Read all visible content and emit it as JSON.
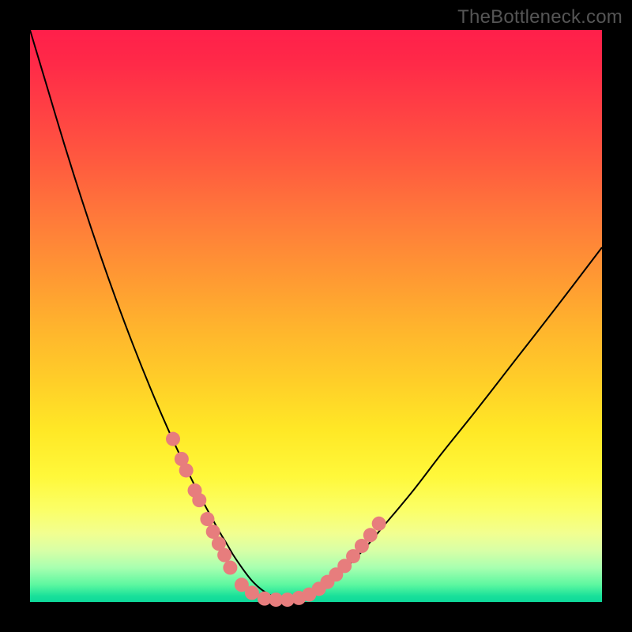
{
  "watermark": "TheBottleneck.com",
  "colors": {
    "bead": "#e77d7d",
    "curve": "#000000",
    "frame": "#000000"
  },
  "chart_data": {
    "type": "line",
    "title": "",
    "xlabel": "",
    "ylabel": "",
    "xlim": [
      0,
      100
    ],
    "ylim": [
      0,
      100
    ],
    "grid": false,
    "legend": false,
    "series": [
      {
        "name": "bottleneck-curve",
        "x": [
          0,
          3,
          6,
          9,
          12,
          15,
          18,
          21,
          24,
          27,
          30,
          33,
          34.5,
          36,
          39,
          42,
          45,
          48,
          51,
          54,
          58,
          62,
          67,
          72,
          78,
          85,
          92,
          100
        ],
        "y": [
          100,
          90,
          80,
          70.5,
          61.5,
          53,
          45,
          37.5,
          30.5,
          24,
          18,
          12.5,
          10,
          7.5,
          3.5,
          1.2,
          0.4,
          0.8,
          2.2,
          4.8,
          8.8,
          13.5,
          19.5,
          26,
          33.5,
          42.5,
          51.5,
          62
        ]
      }
    ],
    "beads": [
      {
        "x": 25.0,
        "y": 28.5
      },
      {
        "x": 26.5,
        "y": 25.0
      },
      {
        "x": 27.3,
        "y": 23.0
      },
      {
        "x": 28.8,
        "y": 19.5
      },
      {
        "x": 29.6,
        "y": 17.8
      },
      {
        "x": 31.0,
        "y": 14.5
      },
      {
        "x": 32.0,
        "y": 12.3
      },
      {
        "x": 33.0,
        "y": 10.2
      },
      {
        "x": 34.0,
        "y": 8.2
      },
      {
        "x": 35.0,
        "y": 6.0
      },
      {
        "x": 37.0,
        "y": 3.0
      },
      {
        "x": 38.8,
        "y": 1.6
      },
      {
        "x": 41.0,
        "y": 0.6
      },
      {
        "x": 43.0,
        "y": 0.4
      },
      {
        "x": 45.0,
        "y": 0.4
      },
      {
        "x": 47.0,
        "y": 0.7
      },
      {
        "x": 48.8,
        "y": 1.3
      },
      {
        "x": 50.5,
        "y": 2.3
      },
      {
        "x": 52.0,
        "y": 3.5
      },
      {
        "x": 53.5,
        "y": 4.8
      },
      {
        "x": 55.0,
        "y": 6.3
      },
      {
        "x": 56.5,
        "y": 8.0
      },
      {
        "x": 58.0,
        "y": 9.8
      },
      {
        "x": 59.5,
        "y": 11.7
      },
      {
        "x": 61.0,
        "y": 13.7
      }
    ]
  }
}
